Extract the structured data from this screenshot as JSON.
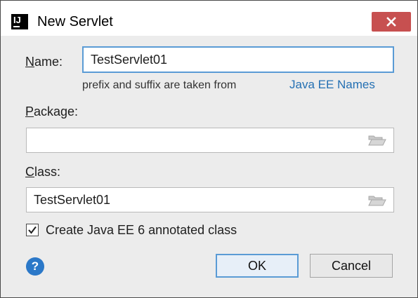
{
  "window": {
    "title": "New Servlet",
    "app_icon_text": "IJ",
    "app_icon_name": "intellij-icon",
    "close_icon_name": "close-icon"
  },
  "form": {
    "name_label": "Name:",
    "name_value": "TestServlet01",
    "hint_text": "prefix and suffix are taken from",
    "hint_link": "Java EE Names",
    "package_label": "Package:",
    "package_value": "",
    "class_label": "Class:",
    "class_value": "TestServlet01",
    "folder_icon_name": "folder-icon",
    "checkbox_label": "Create Java EE 6 annotated class",
    "checkbox_checked": true
  },
  "footer": {
    "help_label": "?",
    "help_icon_name": "help-icon",
    "ok_label": "OK",
    "cancel_label": "Cancel"
  },
  "colors": {
    "link": "#2470b3",
    "focus_border": "#5a9bd5",
    "close_button": "#c75050",
    "help_button": "#2b78c8"
  }
}
